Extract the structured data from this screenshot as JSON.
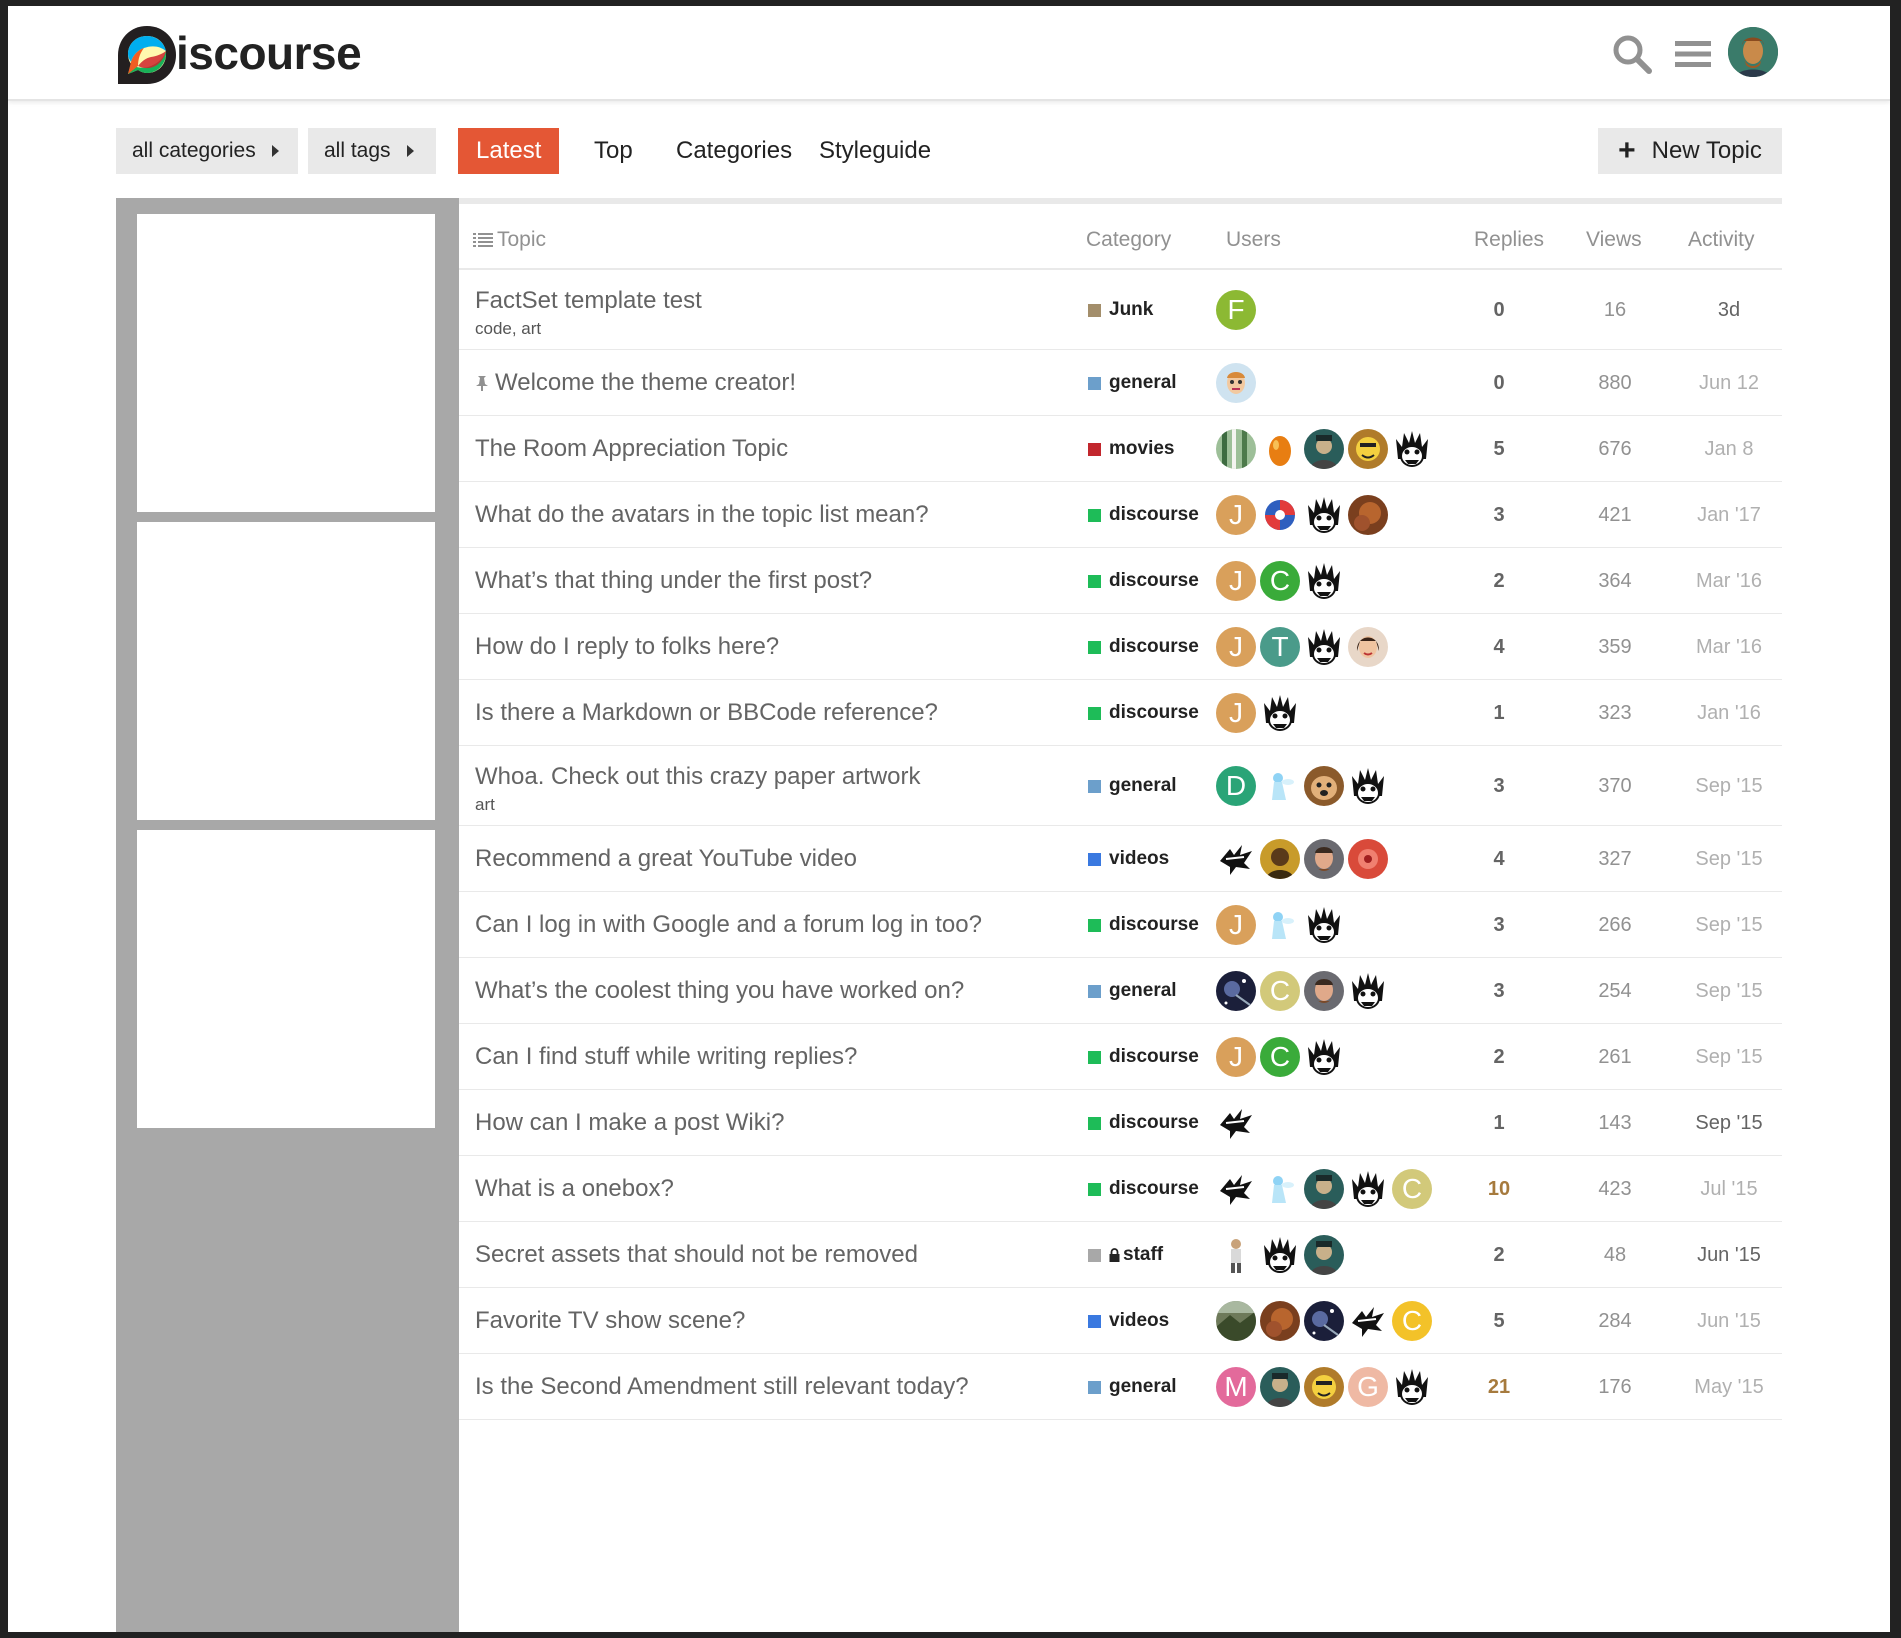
{
  "header": {
    "logo_text": "iscourse"
  },
  "nav": {
    "categories_dropdown": "all categories",
    "tags_dropdown": "all tags",
    "tabs": [
      "Latest",
      "Top",
      "Categories",
      "Styleguide"
    ],
    "new_topic": "New Topic"
  },
  "colors": {
    "accent": "#e45735",
    "junk": "#a38e6b",
    "general": "#6c9fcb",
    "movies": "#c2272d",
    "discourse": "#1ebc58",
    "videos": "#3a79e0",
    "staff": "#a8a8a8"
  },
  "list_header": {
    "topic": "Topic",
    "category": "Category",
    "users": "Users",
    "replies": "Replies",
    "views": "Views",
    "activity": "Activity"
  },
  "topics": [
    {
      "title": "FactSet template test",
      "tags": "code, art",
      "category": "Junk",
      "cat_color": "junk",
      "users": [
        {
          "l": "F",
          "c": "#8cb933"
        }
      ],
      "replies": "0",
      "views": "16",
      "activity": "3d"
    },
    {
      "title": "Welcome the theme creator!",
      "pinned": true,
      "category": "general",
      "cat_color": "general",
      "users": [
        {
          "img": "face-light"
        }
      ],
      "replies": "0",
      "views": "880",
      "activity": "Jun 12"
    },
    {
      "title": "The Room Appreciation Topic",
      "category": "movies",
      "cat_color": "movies",
      "users": [
        {
          "img": "forest"
        },
        {
          "img": "egg"
        },
        {
          "img": "dark-teal"
        },
        {
          "img": "cartoon"
        },
        {
          "img": "monster"
        }
      ],
      "replies": "5",
      "views": "676",
      "activity": "Jan 8"
    },
    {
      "title": "What do the avatars in the topic list mean?",
      "category": "discourse",
      "cat_color": "discourse",
      "users": [
        {
          "l": "J",
          "c": "#d9a05b"
        },
        {
          "img": "logo-blue"
        },
        {
          "img": "monster"
        },
        {
          "img": "brown"
        }
      ],
      "replies": "3",
      "views": "421",
      "activity": "Jan '17"
    },
    {
      "title": "What’s that thing under the first post?",
      "category": "discourse",
      "cat_color": "discourse",
      "users": [
        {
          "l": "J",
          "c": "#d9a05b"
        },
        {
          "l": "C",
          "c": "#3aab3a"
        },
        {
          "img": "monster"
        }
      ],
      "replies": "2",
      "views": "364",
      "activity": "Mar '16"
    },
    {
      "title": "How do I reply to folks here?",
      "category": "discourse",
      "cat_color": "discourse",
      "users": [
        {
          "l": "J",
          "c": "#d9a05b"
        },
        {
          "l": "T",
          "c": "#4a9b8a"
        },
        {
          "img": "monster"
        },
        {
          "img": "woman"
        }
      ],
      "replies": "4",
      "views": "359",
      "activity": "Mar '16"
    },
    {
      "title": "Is there a Markdown or BBCode reference?",
      "category": "discourse",
      "cat_color": "discourse",
      "users": [
        {
          "l": "J",
          "c": "#d9a05b"
        },
        {
          "img": "monster"
        }
      ],
      "replies": "1",
      "views": "323",
      "activity": "Jan '16"
    },
    {
      "title": "Whoa. Check out this crazy paper artwork",
      "tags": "art",
      "category": "general",
      "cat_color": "general",
      "users": [
        {
          "l": "D",
          "c": "#2aa477"
        },
        {
          "img": "fairy"
        },
        {
          "img": "dog"
        },
        {
          "img": "monster"
        }
      ],
      "replies": "3",
      "views": "370",
      "activity": "Sep '15"
    },
    {
      "title": "Recommend a great YouTube video",
      "category": "videos",
      "cat_color": "videos",
      "users": [
        {
          "img": "splat"
        },
        {
          "img": "gold"
        },
        {
          "img": "man"
        },
        {
          "img": "red"
        }
      ],
      "replies": "4",
      "views": "327",
      "activity": "Sep '15"
    },
    {
      "title": "Can I log in with Google and a forum log in too?",
      "category": "discourse",
      "cat_color": "discourse",
      "users": [
        {
          "l": "J",
          "c": "#d9a05b"
        },
        {
          "img": "fairy"
        },
        {
          "img": "monster"
        }
      ],
      "replies": "3",
      "views": "266",
      "activity": "Sep '15"
    },
    {
      "title": "What’s the coolest thing you have worked on?",
      "category": "general",
      "cat_color": "general",
      "users": [
        {
          "img": "space"
        },
        {
          "l": "C",
          "c": "#d2c97a"
        },
        {
          "img": "man"
        },
        {
          "img": "monster"
        }
      ],
      "replies": "3",
      "views": "254",
      "activity": "Sep '15"
    },
    {
      "title": "Can I find stuff while writing replies?",
      "category": "discourse",
      "cat_color": "discourse",
      "users": [
        {
          "l": "J",
          "c": "#d9a05b"
        },
        {
          "l": "C",
          "c": "#3aab3a"
        },
        {
          "img": "monster"
        }
      ],
      "replies": "2",
      "views": "261",
      "activity": "Sep '15"
    },
    {
      "title": "How can I make a post Wiki?",
      "category": "discourse",
      "cat_color": "discourse",
      "users": [
        {
          "img": "splat"
        }
      ],
      "replies": "1",
      "views": "143",
      "activity": "Sep '15"
    },
    {
      "title": "What is a onebox?",
      "category": "discourse",
      "cat_color": "discourse",
      "users": [
        {
          "img": "splat"
        },
        {
          "img": "fairy"
        },
        {
          "img": "dark-teal"
        },
        {
          "img": "monster"
        },
        {
          "l": "C",
          "c": "#d2c97a"
        }
      ],
      "replies": "10",
      "views": "423",
      "activity": "Jul '15"
    },
    {
      "title": "Secret assets that should not be removed",
      "category": "staff",
      "locked": true,
      "cat_color": "staff",
      "users": [
        {
          "img": "figure"
        },
        {
          "img": "monster"
        },
        {
          "img": "dark-teal"
        }
      ],
      "replies": "2",
      "views": "48",
      "activity": "Jun '15"
    },
    {
      "title": "Favorite TV show scene?",
      "category": "videos",
      "cat_color": "videos",
      "users": [
        {
          "img": "landscape"
        },
        {
          "img": "brown"
        },
        {
          "img": "space"
        },
        {
          "img": "splat"
        },
        {
          "l": "C",
          "c": "#f3c229"
        }
      ],
      "replies": "5",
      "views": "284",
      "activity": "Jun '15"
    },
    {
      "title": "Is the Second Amendment still relevant today?",
      "category": "general",
      "cat_color": "general",
      "users": [
        {
          "l": "M",
          "c": "#e36a9b"
        },
        {
          "img": "dark-teal"
        },
        {
          "img": "cartoon"
        },
        {
          "l": "G",
          "c": "#efb9a4"
        },
        {
          "img": "monster"
        }
      ],
      "replies": "21",
      "views": "176",
      "activity": "May '15"
    }
  ]
}
